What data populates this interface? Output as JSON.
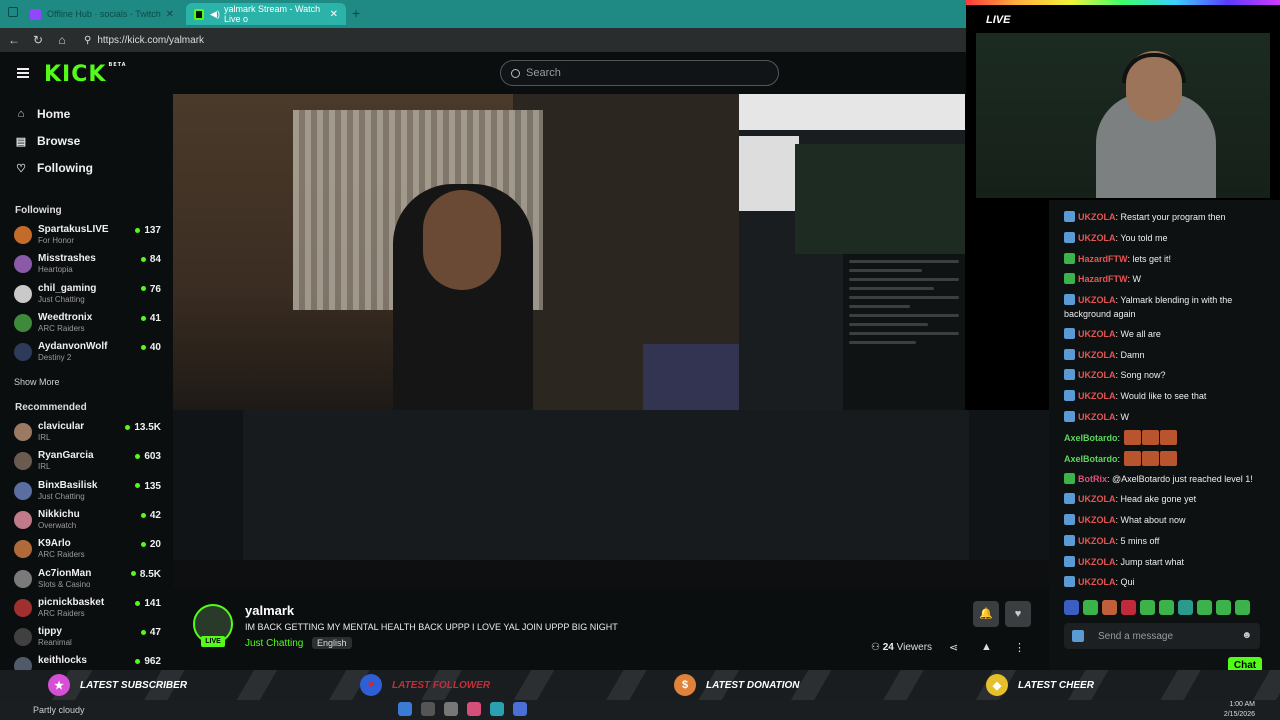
{
  "browser": {
    "tabs": [
      {
        "title": "Offline Hub · socials - Twitch",
        "active": false
      },
      {
        "title": "yalmark Stream - Watch Live o",
        "active": true
      }
    ],
    "url": "https://kick.com/yalmark"
  },
  "kick": {
    "logo": "KICK",
    "logo_sup": "BETA",
    "search_placeholder": "Search"
  },
  "sidebar": {
    "nav": [
      {
        "label": "Home",
        "icon": "home-icon"
      },
      {
        "label": "Browse",
        "icon": "browse-icon"
      },
      {
        "label": "Following",
        "icon": "heart-icon"
      }
    ],
    "following_title": "Following",
    "following": [
      {
        "name": "SpartakusLIVE",
        "category": "For Honor",
        "viewers": "137",
        "color": "#c26b2a"
      },
      {
        "name": "Misstrashes",
        "category": "Heartopia",
        "viewers": "84",
        "color": "#8a5aa8"
      },
      {
        "name": "chil_gaming",
        "category": "Just Chatting",
        "viewers": "76",
        "color": "#c9c9c9"
      },
      {
        "name": "Weedtronix",
        "category": "ARC Raiders",
        "viewers": "41",
        "color": "#3f8a3a"
      },
      {
        "name": "AydanvonWolf",
        "category": "Destiny 2",
        "viewers": "40",
        "color": "#2d3a5a"
      }
    ],
    "show_more": "Show More",
    "recommended_title": "Recommended",
    "recommended": [
      {
        "name": "clavicular",
        "category": "IRL",
        "viewers": "13.5K",
        "color": "#9a7a62"
      },
      {
        "name": "RyanGarcia",
        "category": "IRL",
        "viewers": "603",
        "color": "#6b5a50"
      },
      {
        "name": "BinxBasilisk",
        "category": "Just Chatting",
        "viewers": "135",
        "color": "#5a6fa0"
      },
      {
        "name": "Nikkichu",
        "category": "Overwatch",
        "viewers": "42",
        "color": "#c07a8a"
      },
      {
        "name": "K9Arlo",
        "category": "ARC Raiders",
        "viewers": "20",
        "color": "#b06a3a"
      },
      {
        "name": "Ac7ionMan",
        "category": "Slots & Casino",
        "viewers": "8.5K",
        "color": "#7a7a7a"
      },
      {
        "name": "picnickbasket",
        "category": "ARC Raiders",
        "viewers": "141",
        "color": "#a03030"
      },
      {
        "name": "tippy",
        "category": "Reanimal",
        "viewers": "47",
        "color": "#404040"
      },
      {
        "name": "keithlocks",
        "category": "",
        "viewers": "962",
        "color": "#505a6a"
      }
    ]
  },
  "channel": {
    "name": "yalmark",
    "live_badge": "LIVE",
    "title": "IM BACK GETTING MY MENTAL HEALTH BACK UPPP I LOVE YAL JOIN UPPP BIG NIGHT",
    "category": "Just Chatting",
    "language": "English",
    "viewers_count": "24",
    "viewers_label": "Viewers"
  },
  "webcam": {
    "live_label": "LIVE"
  },
  "chat": {
    "messages": [
      {
        "user": "UKZOLA",
        "color": "red",
        "badge": "#5b9bd5",
        "text": "Restart your program then"
      },
      {
        "user": "UKZOLA",
        "color": "red",
        "badge": "#5b9bd5",
        "text": "You told me"
      },
      {
        "user": "HazardFTW",
        "color": "red",
        "badge": "#3bb34a",
        "text": "lets get it!"
      },
      {
        "user": "HazardFTW",
        "color": "red",
        "badge": "#3bb34a",
        "text": "W"
      },
      {
        "user": "UKZOLA",
        "color": "red",
        "badge": "#5b9bd5",
        "text": "Yalmark blending in with the background again"
      },
      {
        "user": "UKZOLA",
        "color": "red",
        "badge": "#5b9bd5",
        "text": "We all are"
      },
      {
        "user": "UKZOLA",
        "color": "red",
        "badge": "#5b9bd5",
        "text": "Damn"
      },
      {
        "user": "UKZOLA",
        "color": "red",
        "badge": "#5b9bd5",
        "text": "Song now?"
      },
      {
        "user": "UKZOLA",
        "color": "red",
        "badge": "#5b9bd5",
        "text": "Would like to see that"
      },
      {
        "user": "UKZOLA",
        "color": "red",
        "badge": "#5b9bd5",
        "text": "W"
      },
      {
        "user": "AxelBotardo",
        "color": "green",
        "badge": "",
        "text": ""
      },
      {
        "user": "AxelBotardo",
        "color": "green",
        "badge": "",
        "text": ""
      },
      {
        "user": "BotRix",
        "color": "pink",
        "badge": "#3bb34a",
        "text": "@AxelBotardo just reached level 1!"
      },
      {
        "user": "UKZOLA",
        "color": "red",
        "badge": "#5b9bd5",
        "text": "Head ake gone yet"
      },
      {
        "user": "UKZOLA",
        "color": "red",
        "badge": "#5b9bd5",
        "text": "What about now"
      },
      {
        "user": "UKZOLA",
        "color": "red",
        "badge": "#5b9bd5",
        "text": "5 mins off"
      },
      {
        "user": "UKZOLA",
        "color": "red",
        "badge": "#5b9bd5",
        "text": "Jump start what"
      },
      {
        "user": "UKZOLA",
        "color": "red",
        "badge": "#5b9bd5",
        "text": "Qui"
      }
    ],
    "input_placeholder": "Send a message",
    "send_label": "Chat"
  },
  "alerts": [
    {
      "label": "LATEST SUBSCRIBER",
      "icon": "star-icon",
      "icon_color": "#d64fd6"
    },
    {
      "label": "LATEST FOLLOWER",
      "icon": "heart-icon",
      "icon_color": "#2f5fd6"
    },
    {
      "label": "LATEST DONATION",
      "icon": "dollar-icon",
      "icon_color": "#e0823a"
    },
    {
      "label": "LATEST CHEER",
      "icon": "diamond-icon",
      "icon_color": "#e6c02a"
    }
  ],
  "taskbar": {
    "weather": "Partly cloudy",
    "time": "1:00 AM",
    "date": "2/15/2026"
  }
}
